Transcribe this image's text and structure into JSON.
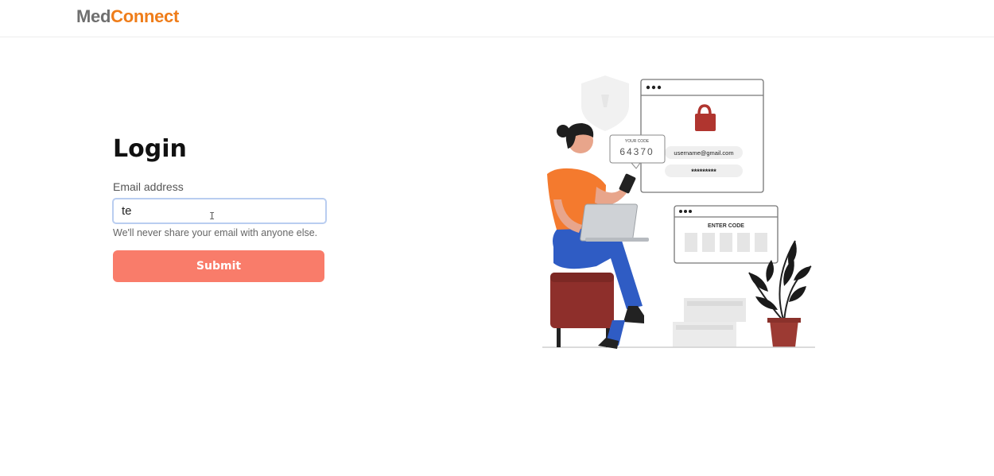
{
  "header": {
    "logo_part1": "Med",
    "logo_part2": "Connect"
  },
  "login": {
    "title": "Login",
    "email_label": "Email address",
    "email_value": "te",
    "help_text": "We'll never share your email with anyone else.",
    "submit_label": "Submit"
  },
  "illustration": {
    "code_caption": "YOUR CODE",
    "code_value": "64370",
    "username": "username@gmail.com",
    "password_mask": "*********",
    "enter_code": "ENTER CODE"
  },
  "colors": {
    "brand_gray": "#6f6f6f",
    "brand_orange": "#ef7d1a",
    "submit": "#f97c6a",
    "input_focus_border": "#b9cdf0"
  },
  "icons": {
    "text_cursor": "I-beam cursor"
  }
}
